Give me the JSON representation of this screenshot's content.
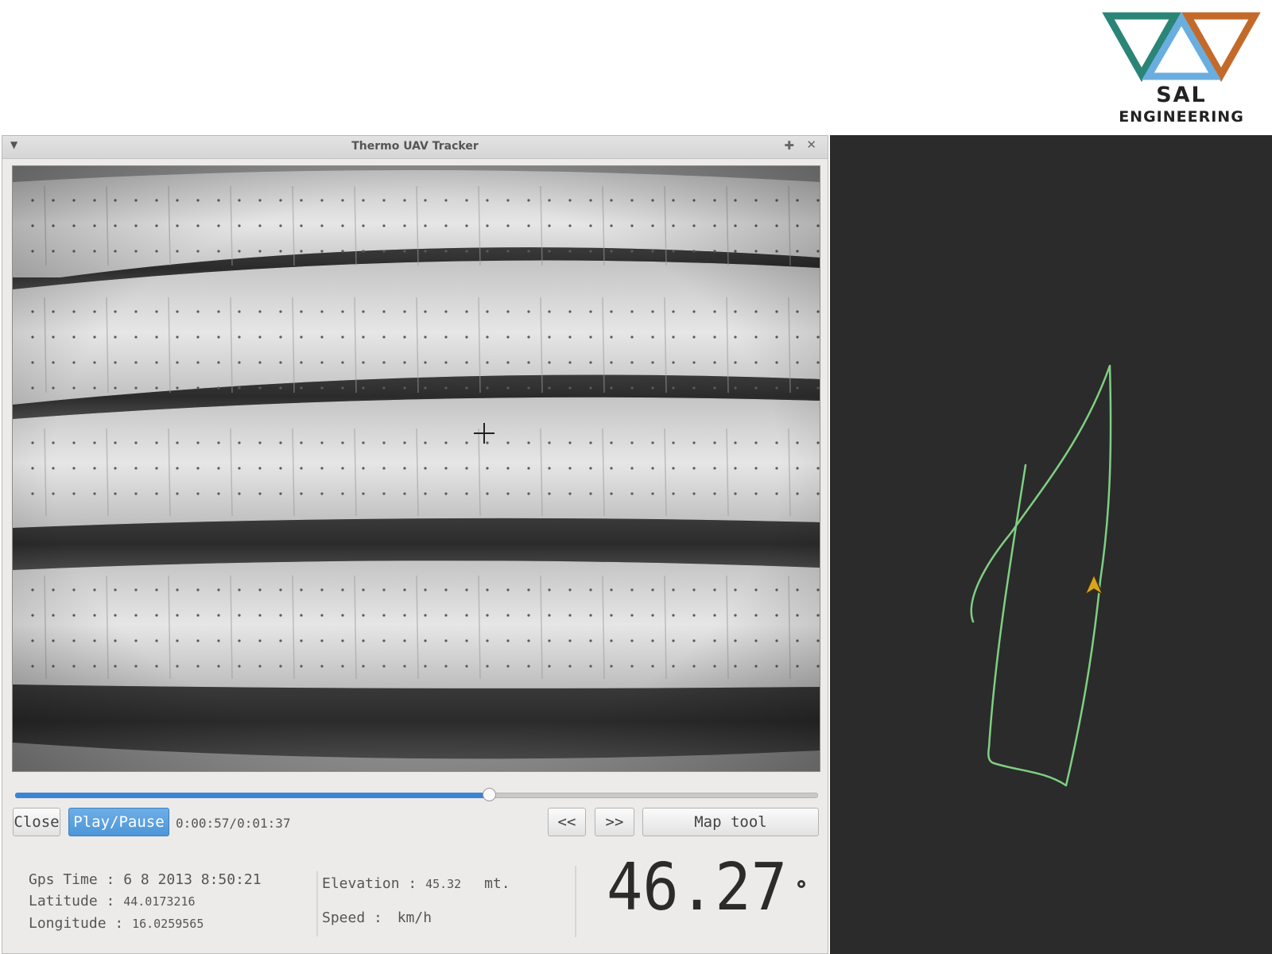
{
  "brand": {
    "line1": "SAL",
    "line2": "ENGINEERING"
  },
  "window": {
    "title": "Thermo UAV Tracker"
  },
  "playback": {
    "progress": 0.59,
    "time": "0:00:57/0:01:37"
  },
  "buttons": {
    "close": "Close",
    "play_pause": "Play/Pause",
    "rewind": "<<",
    "forward": ">>",
    "map_tool": "Map tool"
  },
  "info": {
    "gps_time": "Gps Time : 6 8 2013 8:50:21",
    "latitude_label": "Latitude :",
    "latitude_value": "44.0173216",
    "longitude_label": "Longitude :",
    "longitude_value": "16.0259565",
    "elevation_label": "Elevation :",
    "elevation_value": "45.32",
    "elevation_unit": "mt.",
    "speed_label": "Speed :",
    "speed_unit": "km/h"
  },
  "display": {
    "value": "46.27"
  },
  "colors": {
    "accent": "#4d96d8",
    "track": "#7fcf82",
    "marker": "#d9a520",
    "logo_teal": "#2a8577",
    "logo_blue": "#6aaee0",
    "logo_orange": "#c36a2a"
  },
  "icons": {
    "menu": "chevron-down-icon",
    "pin": "pin-icon",
    "close": "close-icon",
    "crosshair": "crosshair-icon",
    "uav": "uav-arrow-icon"
  }
}
